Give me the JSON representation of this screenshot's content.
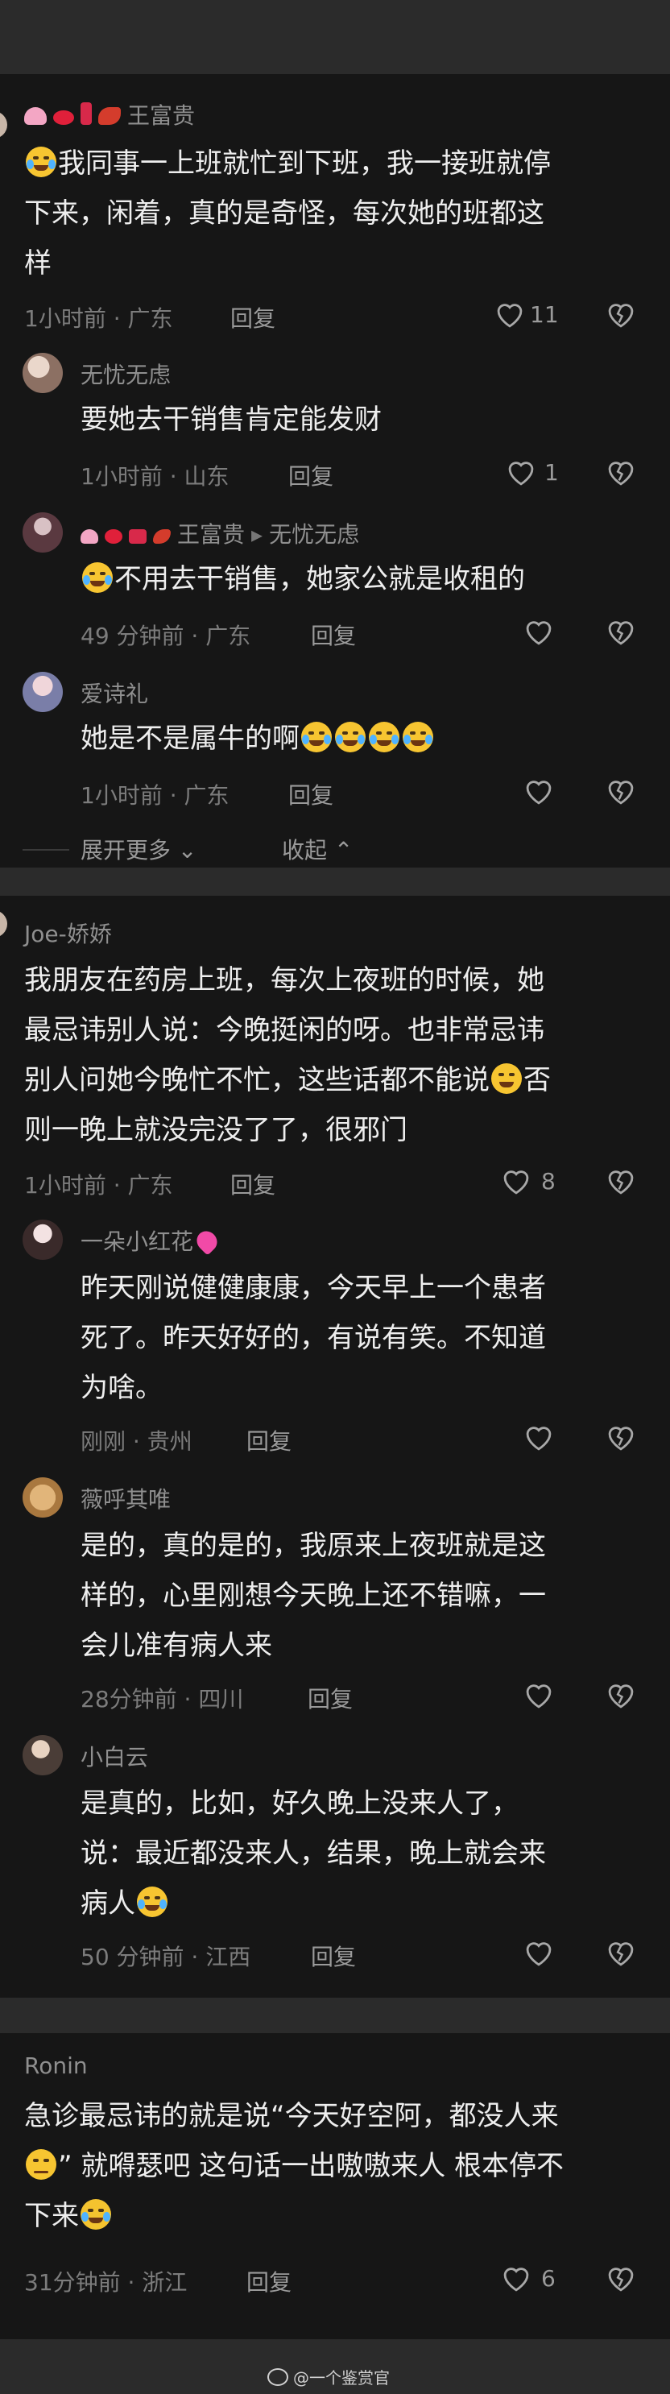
{
  "threads": [
    {
      "author": "王富贵",
      "text_a": "我同事一上班就忙到下班，我一接班就停",
      "text_b": "下来，闲着，真的是奇怪，每次她的班都这",
      "text_c": "样",
      "meta": "1小时前 · 广东",
      "reply": "回复",
      "likes": "11",
      "replies": [
        {
          "author": "无忧无虑",
          "text": "要她去干销售肯定能发财",
          "meta": "1小时前 · 山东",
          "reply": "回复",
          "likes": "1"
        },
        {
          "author": "王富贵",
          "reply_to": "无忧无虑",
          "text": "不用去干销售，她家公就是收租的",
          "meta": "49 分钟前 · 广东",
          "reply": "回复"
        },
        {
          "author": "爱诗礼",
          "text": "她是不是属牛的啊",
          "meta": "1小时前 · 广东",
          "reply": "回复"
        }
      ],
      "expand": "展开更多",
      "collapse": "收起"
    },
    {
      "author": "Joe-娇娇",
      "text_a": "我朋友在药房上班，每次上夜班的时候，她",
      "text_b": "最忌讳别人说：今晚挺闲的呀。也非常忌讳",
      "text_c": "别人问她今晚忙不忙，这些话都不能说",
      "text_c2": "否",
      "text_d": "则一晚上就没完没了了，很邪门",
      "meta": "1小时前 · 广东",
      "reply": "回复",
      "likes": "8",
      "replies": [
        {
          "author": "一朵小红花",
          "text_a": "昨天刚说健健康康，今天早上一个患者",
          "text_b": "死了。昨天好好的，有说有笑。不知道",
          "text_c": "为啥。",
          "meta": "刚刚 · 贵州",
          "reply": "回复"
        },
        {
          "author": "薇呼其唯",
          "text_a": "是的，真的是的，我原来上夜班就是这",
          "text_b": "样的，心里刚想今天晚上还不错嘛，一",
          "text_c": "会儿准有病人来",
          "meta": "28分钟前 · 四川",
          "reply": "回复"
        },
        {
          "author": "小白云",
          "text_a": "是真的，比如，好久晚上没来人了，",
          "text_b": "说：最近都没来人，结果，晚上就会来",
          "text_c": "病人",
          "meta": "50 分钟前 · 江西",
          "reply": "回复"
        }
      ]
    },
    {
      "author": "Ronin",
      "text_a": "急诊最忌讳的就是说“今天好空阿，都没人来",
      "text_b": "” 就嘚瑟吧 这句话一出嗷嗷来人 根本停不",
      "text_c": "下来",
      "meta": "31分钟前 · 浙江",
      "reply": "回复",
      "likes": "6"
    }
  ],
  "watermark": "@一个鉴赏官",
  "colors": {
    "background": "#161616",
    "separator": "#2b2b2b",
    "emoji": "#f7c531"
  },
  "icons": [
    "heart-icon",
    "dislike-icon",
    "chevron-down-icon",
    "chevron-up-icon",
    "laughing-crying-emoji",
    "sweat-smile-emoji",
    "loudly-crying-emoji",
    "unamused-emoji",
    "weibo-logo-icon"
  ]
}
